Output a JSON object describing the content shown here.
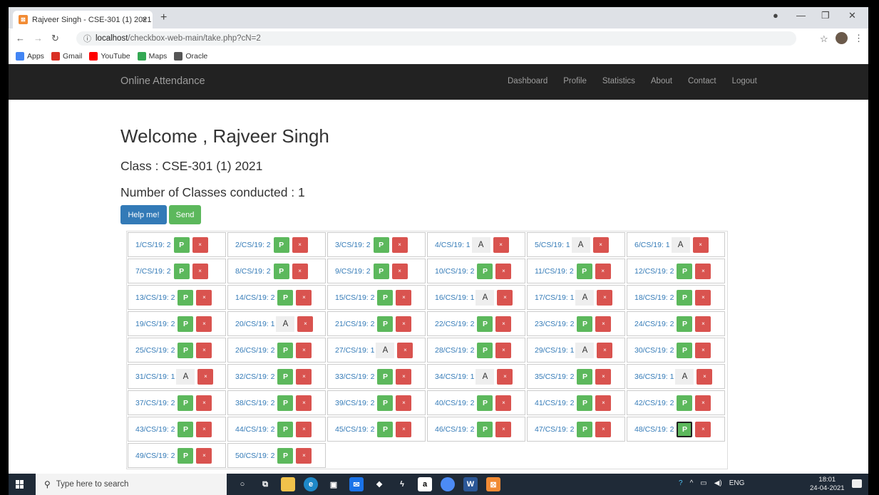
{
  "browser": {
    "tab_title": "Rajveer Singh - CSE-301 (1) 2021",
    "tab_close": "×",
    "new_tab": "+",
    "url_host": "localhost",
    "url_path": "/checkbox-web-main/take.php?cN=2",
    "bookmarks": [
      {
        "label": "Apps",
        "color": "#4285f4"
      },
      {
        "label": "Gmail",
        "color": "#d93025"
      },
      {
        "label": "YouTube",
        "color": "#ff0000"
      },
      {
        "label": "Maps",
        "color": "#34a853"
      },
      {
        "label": "Oracle",
        "color": "#555555"
      }
    ]
  },
  "navbar": {
    "brand": "Online Attendance",
    "links": [
      "Dashboard",
      "Profile",
      "Statistics",
      "About",
      "Contact",
      "Logout"
    ]
  },
  "page": {
    "welcome": "Welcome , Rajveer Singh",
    "class_line": "Class : CSE-301 (1) 2021",
    "classes_conducted": "Number of Classes conducted : 1",
    "help_button": "Help me!",
    "send_button": "Send"
  },
  "attendance": [
    {
      "roll": "1/CS/19:",
      "count": "2",
      "status": "P"
    },
    {
      "roll": "2/CS/19:",
      "count": "2",
      "status": "P"
    },
    {
      "roll": "3/CS/19:",
      "count": "2",
      "status": "P"
    },
    {
      "roll": "4/CS/19:",
      "count": "1",
      "status": "A"
    },
    {
      "roll": "5/CS/19:",
      "count": "1",
      "status": "A"
    },
    {
      "roll": "6/CS/19:",
      "count": "1",
      "status": "A"
    },
    {
      "roll": "7/CS/19:",
      "count": "2",
      "status": "P"
    },
    {
      "roll": "8/CS/19:",
      "count": "2",
      "status": "P"
    },
    {
      "roll": "9/CS/19:",
      "count": "2",
      "status": "P"
    },
    {
      "roll": "10/CS/19:",
      "count": "2",
      "status": "P"
    },
    {
      "roll": "11/CS/19:",
      "count": "2",
      "status": "P"
    },
    {
      "roll": "12/CS/19:",
      "count": "2",
      "status": "P"
    },
    {
      "roll": "13/CS/19:",
      "count": "2",
      "status": "P"
    },
    {
      "roll": "14/CS/19:",
      "count": "2",
      "status": "P"
    },
    {
      "roll": "15/CS/19:",
      "count": "2",
      "status": "P"
    },
    {
      "roll": "16/CS/19:",
      "count": "1",
      "status": "A"
    },
    {
      "roll": "17/CS/19:",
      "count": "1",
      "status": "A"
    },
    {
      "roll": "18/CS/19:",
      "count": "2",
      "status": "P"
    },
    {
      "roll": "19/CS/19:",
      "count": "2",
      "status": "P"
    },
    {
      "roll": "20/CS/19:",
      "count": "1",
      "status": "A"
    },
    {
      "roll": "21/CS/19:",
      "count": "2",
      "status": "P"
    },
    {
      "roll": "22/CS/19:",
      "count": "2",
      "status": "P"
    },
    {
      "roll": "23/CS/19:",
      "count": "2",
      "status": "P"
    },
    {
      "roll": "24/CS/19:",
      "count": "2",
      "status": "P"
    },
    {
      "roll": "25/CS/19:",
      "count": "2",
      "status": "P"
    },
    {
      "roll": "26/CS/19:",
      "count": "2",
      "status": "P"
    },
    {
      "roll": "27/CS/19:",
      "count": "1",
      "status": "A"
    },
    {
      "roll": "28/CS/19:",
      "count": "2",
      "status": "P"
    },
    {
      "roll": "29/CS/19:",
      "count": "1",
      "status": "A"
    },
    {
      "roll": "30/CS/19:",
      "count": "2",
      "status": "P"
    },
    {
      "roll": "31/CS/19:",
      "count": "1",
      "status": "A"
    },
    {
      "roll": "32/CS/19:",
      "count": "2",
      "status": "P"
    },
    {
      "roll": "33/CS/19:",
      "count": "2",
      "status": "P"
    },
    {
      "roll": "34/CS/19:",
      "count": "1",
      "status": "A"
    },
    {
      "roll": "35/CS/19:",
      "count": "2",
      "status": "P"
    },
    {
      "roll": "36/CS/19:",
      "count": "1",
      "status": "A"
    },
    {
      "roll": "37/CS/19:",
      "count": "2",
      "status": "P"
    },
    {
      "roll": "38/CS/19:",
      "count": "2",
      "status": "P"
    },
    {
      "roll": "39/CS/19:",
      "count": "2",
      "status": "P"
    },
    {
      "roll": "40/CS/19:",
      "count": "2",
      "status": "P"
    },
    {
      "roll": "41/CS/19:",
      "count": "2",
      "status": "P"
    },
    {
      "roll": "42/CS/19:",
      "count": "2",
      "status": "P"
    },
    {
      "roll": "43/CS/19:",
      "count": "2",
      "status": "P"
    },
    {
      "roll": "44/CS/19:",
      "count": "2",
      "status": "P"
    },
    {
      "roll": "45/CS/19:",
      "count": "2",
      "status": "P"
    },
    {
      "roll": "46/CS/19:",
      "count": "2",
      "status": "P"
    },
    {
      "roll": "47/CS/19:",
      "count": "2",
      "status": "P"
    },
    {
      "roll": "48/CS/19:",
      "count": "2",
      "status": "P",
      "focused": true
    },
    {
      "roll": "49/CS/19:",
      "count": "2",
      "status": "P"
    },
    {
      "roll": "50/CS/19:",
      "count": "2",
      "status": "P"
    }
  ],
  "absent_mark": "×",
  "taskbar": {
    "search_placeholder": "Type here to search",
    "lang": "ENG",
    "time": "18:01",
    "date": "24-04-2021"
  },
  "colors": {
    "navbar_bg": "#222222",
    "present_green": "#5cb85c",
    "absent_red": "#d9534f",
    "link_blue": "#337ab7",
    "help_blue": "#337ab7"
  }
}
